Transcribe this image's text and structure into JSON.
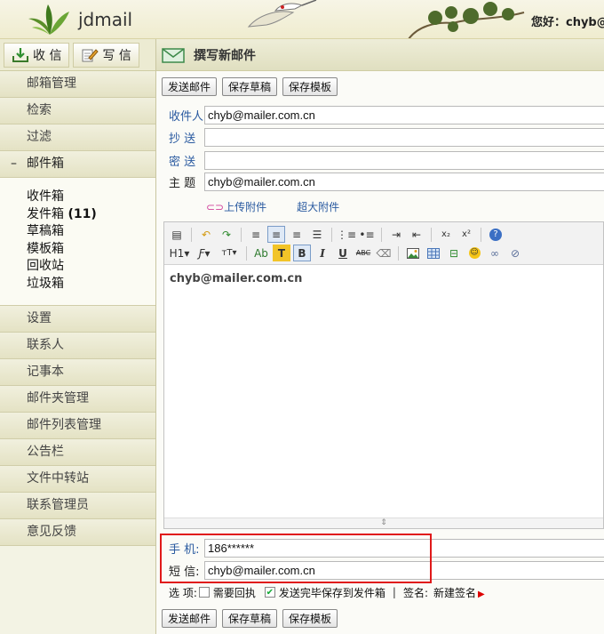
{
  "header": {
    "logo_text": "jdmail",
    "greeting": "您好：chyb@"
  },
  "sidebar": {
    "receive_label": "收 信",
    "compose_label": "写 信",
    "top_items": [
      "邮箱管理",
      "检索",
      "过滤"
    ],
    "mailbox_label": "邮件箱",
    "mailbox_collapse": "–",
    "folders": [
      {
        "name": "收件箱",
        "count": ""
      },
      {
        "name": "发件箱",
        "count": "(11)"
      },
      {
        "name": "草稿箱",
        "count": ""
      },
      {
        "name": "模板箱",
        "count": ""
      },
      {
        "name": "回收站",
        "count": ""
      },
      {
        "name": "垃圾箱",
        "count": ""
      }
    ],
    "bottom_items": [
      "设置",
      "联系人",
      "记事本",
      "邮件夹管理",
      "邮件列表管理",
      "公告栏",
      "文件中转站",
      "联系管理员",
      "意见反馈"
    ]
  },
  "main": {
    "title": "撰写新邮件",
    "buttons": {
      "send": "发送邮件",
      "save_draft": "保存草稿",
      "save_template": "保存模板"
    },
    "fields": {
      "to_label": "收件人",
      "to_value": "chyb@mailer.com.cn",
      "cc_label": "抄 送",
      "cc_value": "",
      "bcc_label": "密 送",
      "bcc_value": "",
      "subject_label": "主 题",
      "subject_value": "chyb@mailer.com.cn"
    },
    "attach": {
      "upload": "上传附件",
      "large": "超大附件"
    },
    "editor": {
      "heading_label": "H1",
      "font_label": "Ƒ",
      "size_label": "тT",
      "color_label": "Ab",
      "bg_label": "T",
      "bold_label": "B",
      "italic_label": "I",
      "underline_label": "U",
      "strike_label": "ABC",
      "body_text": "chyb@mailer.com.cn"
    },
    "sms": {
      "phone_label": "手 机:",
      "phone_value": "186******",
      "sms_label": "短 信:",
      "sms_value": "chyb@mailer.com.cn"
    },
    "options": {
      "label": "选 项:",
      "receipt": "需要回执",
      "receipt_checked": false,
      "save_sent": "发送完毕保存到发件箱",
      "save_sent_checked": true,
      "signature_label": "签名:",
      "signature_value": "新建签名"
    }
  }
}
